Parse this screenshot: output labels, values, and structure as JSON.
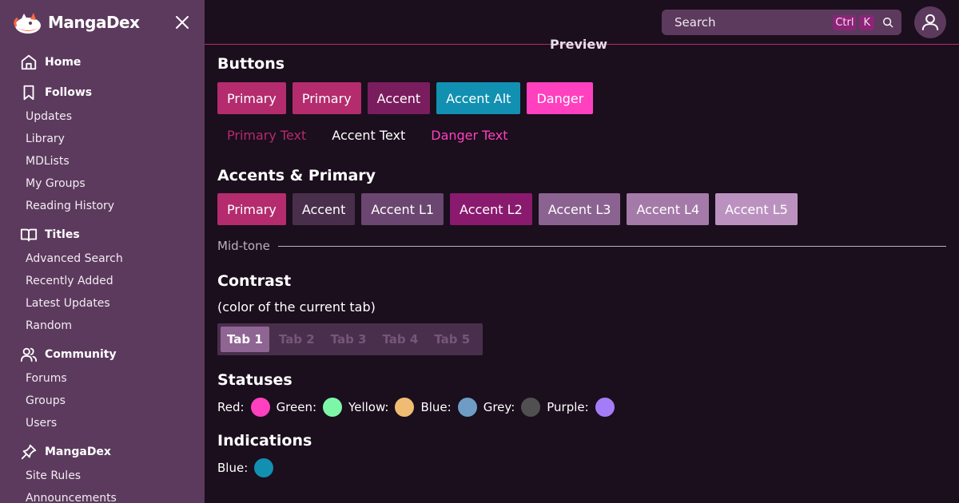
{
  "app": {
    "name": "MangaDex"
  },
  "sidebar": {
    "sections": [
      {
        "label": "Home",
        "icon": "home-icon",
        "items": []
      },
      {
        "label": "Follows",
        "icon": "bookmark-icon",
        "items": [
          "Updates",
          "Library",
          "MDLists",
          "My Groups",
          "Reading History"
        ]
      },
      {
        "label": "Titles",
        "icon": "book-open-icon",
        "items": [
          "Advanced Search",
          "Recently Added",
          "Latest Updates",
          "Random"
        ]
      },
      {
        "label": "Community",
        "icon": "users-icon",
        "items": [
          "Forums",
          "Groups",
          "Users"
        ]
      },
      {
        "label": "MangaDex",
        "icon": "pin-icon",
        "items": [
          "Site Rules",
          "Announcements"
        ]
      }
    ]
  },
  "topbar": {
    "search_placeholder": "Search",
    "shortcut_ctrl": "Ctrl",
    "shortcut_key": "K"
  },
  "main": {
    "preview_label": "Preview",
    "buttons_title": "Buttons",
    "buttons": [
      {
        "label": "Primary",
        "color": "#b42b6e"
      },
      {
        "label": "Primary",
        "color": "#b42b6e"
      },
      {
        "label": "Accent",
        "color": "#7a1d5e"
      },
      {
        "label": "Accent Alt",
        "color": "#1190b2"
      },
      {
        "label": "Danger",
        "color": "#ff40bf"
      }
    ],
    "text_buttons": [
      {
        "label": "Primary Text",
        "color": "#b42b6e"
      },
      {
        "label": "Accent Text",
        "color": "#ffffff"
      },
      {
        "label": "Danger Text",
        "color": "#ff40bf"
      }
    ],
    "accents_title": "Accents & Primary",
    "accents": [
      {
        "label": "Primary",
        "color": "#b42b6e"
      },
      {
        "label": "Accent",
        "color": "#4a2f4d"
      },
      {
        "label": "Accent L1",
        "color": "#6b4670"
      },
      {
        "label": "Accent L2",
        "color": "#8a1a6e"
      },
      {
        "label": "Accent L3",
        "color": "#8b6390"
      },
      {
        "label": "Accent L4",
        "color": "#a47aa8"
      },
      {
        "label": "Accent L5",
        "color": "#bb92bf"
      }
    ],
    "midtone_label": "Mid-tone",
    "contrast_title": "Contrast",
    "contrast_note": "(color of the current tab)",
    "tabs": [
      "Tab 1",
      "Tab 2",
      "Tab 3",
      "Tab 4",
      "Tab 5"
    ],
    "active_tab": 0,
    "statuses_title": "Statuses",
    "statuses": [
      {
        "label": "Red:",
        "color": "#ff40bf"
      },
      {
        "label": "Green:",
        "color": "#7cf7a8"
      },
      {
        "label": "Yellow:",
        "color": "#f0bc73"
      },
      {
        "label": "Blue:",
        "color": "#6f9cc4"
      },
      {
        "label": "Grey:",
        "color": "#505050"
      },
      {
        "label": "Purple:",
        "color": "#a57cf7"
      }
    ],
    "indications_title": "Indications",
    "indications": [
      {
        "label": "Blue:",
        "color": "#1190b2"
      }
    ]
  }
}
